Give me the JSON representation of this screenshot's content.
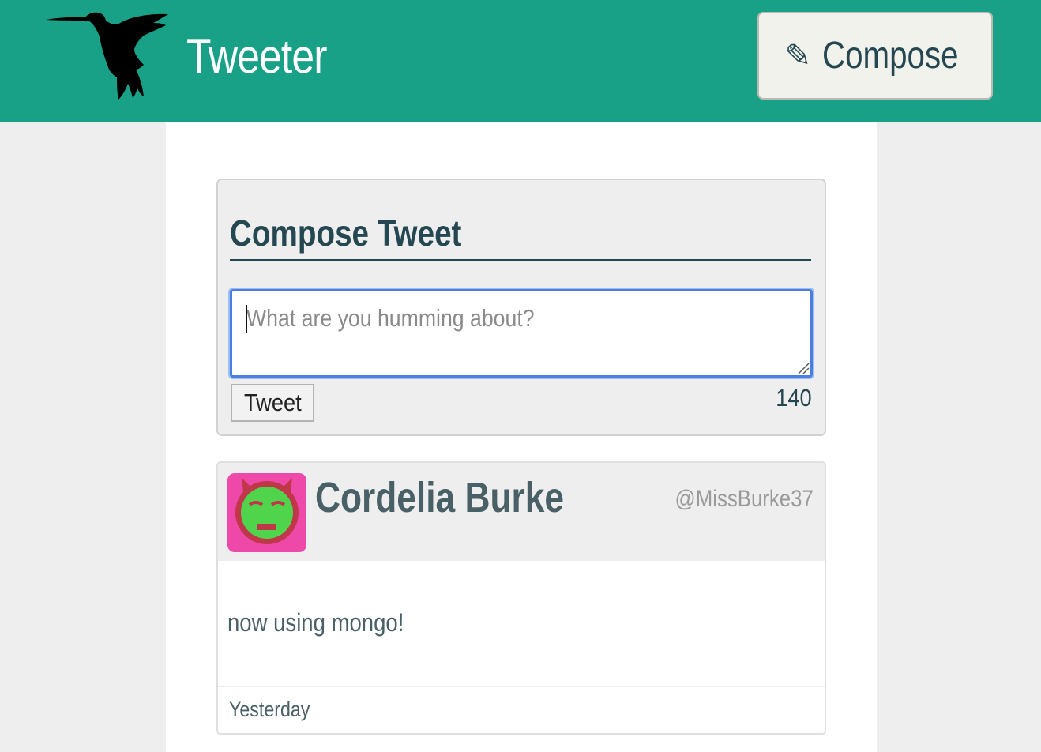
{
  "nav": {
    "brand": "Tweeter",
    "logo_icon": "hummingbird-icon",
    "compose_icon": "✎",
    "compose_label": "Compose"
  },
  "new_tweet": {
    "heading": "Compose Tweet",
    "placeholder": "What are you humming about?",
    "submit_label": "Tweet",
    "char_counter": "140"
  },
  "tweets": [
    {
      "author_name": "Cordelia Burke",
      "handle": "@MissBurke37",
      "avatar_icon": "smiley-devil-avatar-icon",
      "content": "now using mongo!",
      "timestamp": "Yesterday"
    }
  ],
  "colors": {
    "brand_green": "#19a187",
    "text_dark": "#244751",
    "avatar_pink": "#ee48a8",
    "avatar_face": "#4fd44b"
  }
}
